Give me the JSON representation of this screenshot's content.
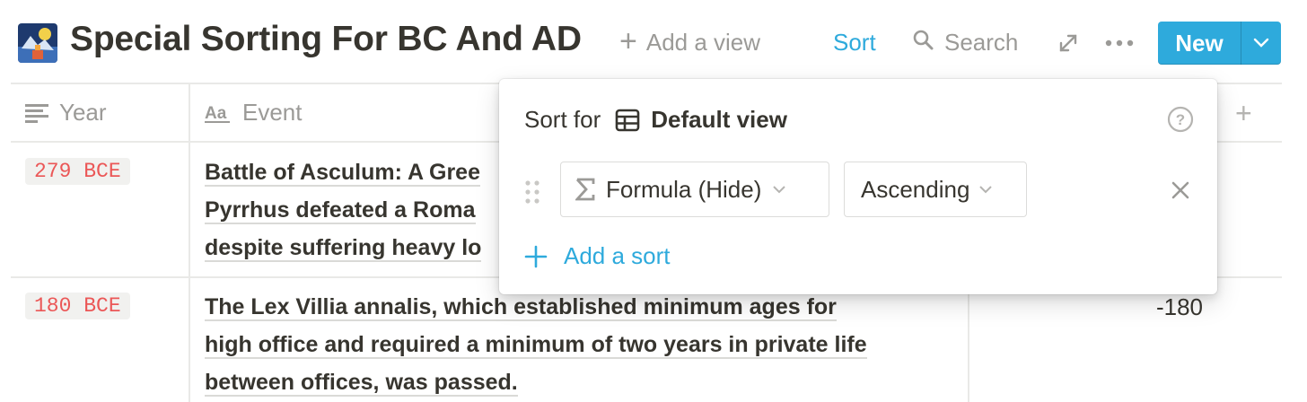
{
  "header": {
    "title": "Special Sorting For BC And AD",
    "add_view_label": "Add a view",
    "sort_label": "Sort",
    "search_label": "Search",
    "new_label": "New"
  },
  "table": {
    "columns": [
      {
        "label": "Year",
        "icon": "text-lines-icon"
      },
      {
        "label": "Event",
        "icon": "text-aa-icon"
      }
    ],
    "rows": [
      {
        "year": "279 BCE",
        "event_lines": [
          "Battle of Asculum: A Gree",
          "Pyrrhus defeated a Roma",
          "despite suffering heavy lo"
        ],
        "formula": ""
      },
      {
        "year": "180 BCE",
        "event_lines": [
          "The Lex Villia annalis, which established minimum ages for",
          "high office and required a minimum of two years in private life",
          "between offices, was passed."
        ],
        "formula": "-180"
      }
    ]
  },
  "sort_popup": {
    "sort_for_label": "Sort for",
    "view_name": "Default view",
    "property_label": "Formula (Hide)",
    "direction_label": "Ascending",
    "add_sort_label": "Add a sort"
  },
  "colors": {
    "accent": "#2eaadc",
    "tag_text": "#eb5757",
    "tag_bg": "#f1f1ef",
    "muted": "#9b9a97",
    "text": "#37352f"
  }
}
